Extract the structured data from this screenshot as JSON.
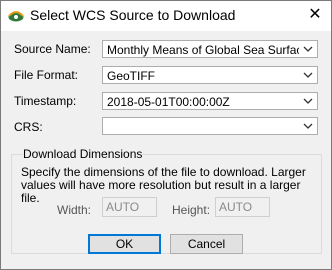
{
  "window": {
    "title": "Select WCS Source to Download"
  },
  "form": {
    "source_name": {
      "label": "Source Name:",
      "value": "Monthly Means of Global Sea Surface Te"
    },
    "file_format": {
      "label": "File Format:",
      "value": "GeoTIFF"
    },
    "timestamp": {
      "label": "Timestamp:",
      "value": "2018-05-01T00:00:00Z"
    },
    "crs": {
      "label": "CRS:",
      "value": ""
    }
  },
  "dimensions": {
    "title": "Download Dimensions",
    "description": "Specify the dimensions of the file to download. Larger values will have more resolution but result in a larger file.",
    "width": {
      "label": "Width:",
      "value": "AUTO"
    },
    "height": {
      "label": "Height:",
      "value": "AUTO"
    }
  },
  "buttons": {
    "ok": "OK",
    "cancel": "Cancel"
  }
}
